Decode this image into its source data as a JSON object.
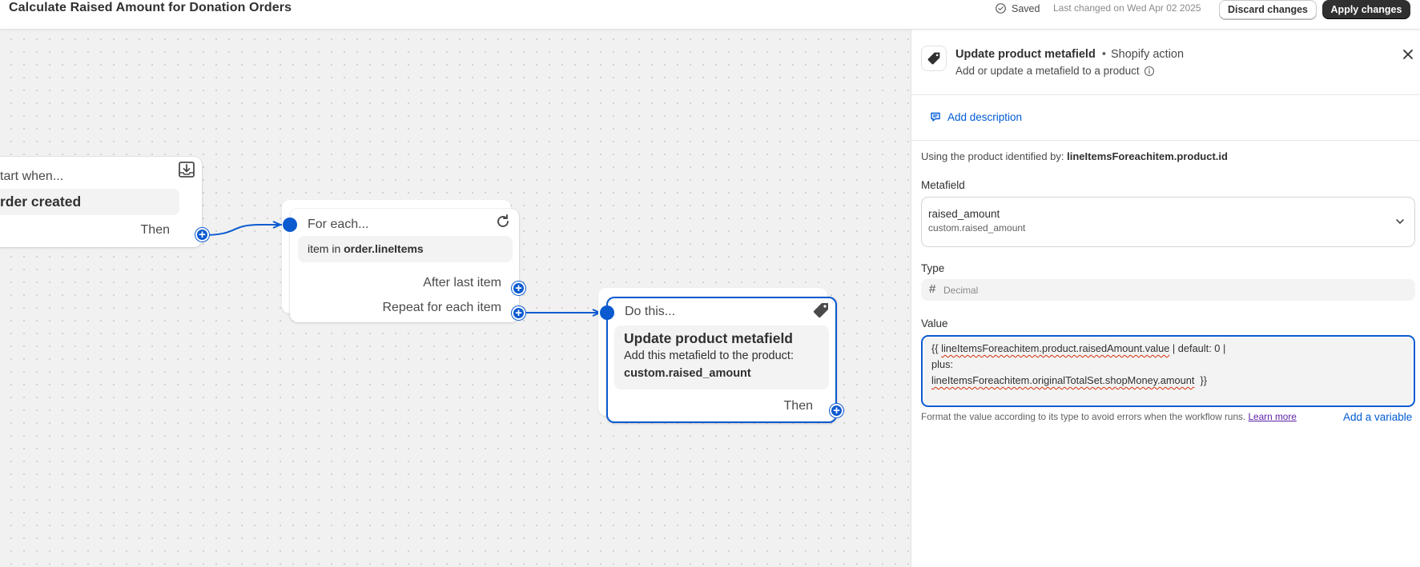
{
  "header": {
    "title": "Calculate Raised Amount for Donation Orders",
    "saved_label": "Saved",
    "last_changed": "Last changed on Wed Apr 02 2025",
    "discard_label": "Discard changes",
    "apply_label": "Apply changes"
  },
  "canvas": {
    "trigger": {
      "heading": "tart when...",
      "title": "rder created",
      "then_label": "Then",
      "icon": "download-tray-icon"
    },
    "foreach": {
      "heading": "For each...",
      "item_prefix": "item in ",
      "item_bold": "order.lineItems",
      "after_last_label": "After last item",
      "repeat_label": "Repeat for each item",
      "icon": "refresh-icon"
    },
    "action": {
      "heading": "Do this...",
      "title": "Update product metafield",
      "desc": "Add this metafield to the product:",
      "metafield": "custom.raised_amount",
      "then_label": "Then",
      "icon": "tag-icon"
    }
  },
  "panel": {
    "title": "Update product metafield",
    "separator": "•",
    "source": "Shopify action",
    "subtitle": "Add or update a metafield to a product",
    "add_description": "Add description",
    "using_prefix": "Using the product identified by:",
    "using_value": "lineItemsForeachitem.product.id",
    "metafield_label": "Metafield",
    "metafield_name": "raised_amount",
    "metafield_key": "custom.raised_amount",
    "type_label": "Type",
    "type_hash": "#",
    "type_value": "Decimal",
    "value_label": "Value",
    "value_line1_open": "{{ ",
    "value_line1_var": "lineItemsForeachitem.product.raisedAmount.value",
    "value_line1_rest": " | default: 0 |",
    "value_line2": "plus:",
    "value_line3_var": "lineItemsForeachitem.originalTotalSet.shopMoney.amount",
    "value_line3_close": "  }}",
    "helper_text": "Format the value according to its type to avoid errors when the workflow runs. ",
    "learn_more": "Learn more",
    "add_variable": "Add a variable"
  },
  "colors": {
    "accent": "#0b5ad0",
    "link": "#005bd3",
    "primary_button": "#303030"
  }
}
